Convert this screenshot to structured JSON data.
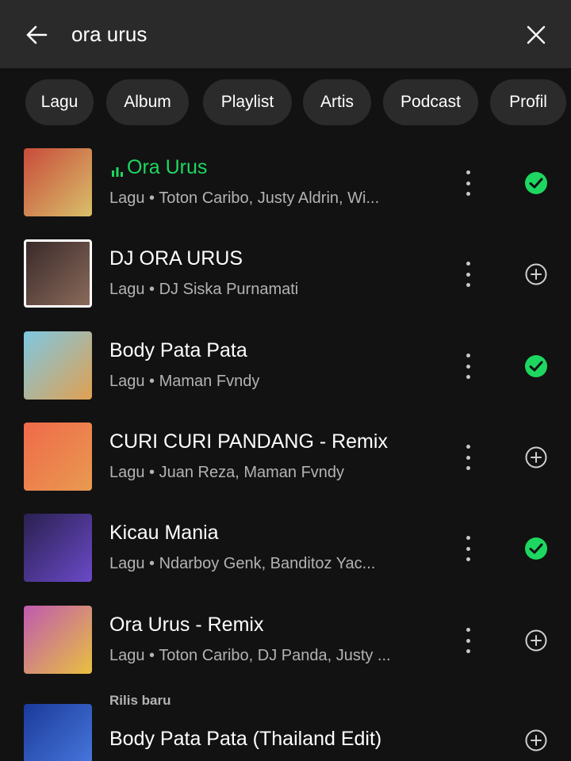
{
  "search": {
    "query": "ora urus"
  },
  "filters": [
    "Lagu",
    "Album",
    "Playlist",
    "Artis",
    "Podcast",
    "Profil"
  ],
  "results": [
    {
      "title": "Ora Urus",
      "subtitle": "Lagu • Toton Caribo, Justy Aldrin, Wi...",
      "saved": true,
      "playing": true,
      "cover_colors": [
        "#c94b3b",
        "#d8c06a"
      ]
    },
    {
      "title": "DJ ORA URUS",
      "subtitle": "Lagu • DJ Siska Purnamati",
      "saved": false,
      "playing": false,
      "cover_colors": [
        "#3a2a2a",
        "#8a6a5a"
      ]
    },
    {
      "title": "Body Pata Pata",
      "subtitle": "Lagu • Maman Fvndy",
      "saved": true,
      "playing": false,
      "cover_colors": [
        "#7ec8e3",
        "#e0a050"
      ]
    },
    {
      "title": "CURI CURI PANDANG - Remix",
      "subtitle": "Lagu • Juan Reza, Maman Fvndy",
      "saved": false,
      "playing": false,
      "cover_colors": [
        "#f06a4a",
        "#e89a50"
      ]
    },
    {
      "title": "Kicau Mania",
      "subtitle": "Lagu • Ndarboy Genk, Banditoz Yac...",
      "saved": true,
      "playing": false,
      "cover_colors": [
        "#2a2050",
        "#6a4ac8"
      ]
    },
    {
      "title": "Ora Urus - Remix",
      "subtitle": "Lagu • Toton Caribo, DJ Panda, Justy ...",
      "saved": false,
      "playing": false,
      "cover_colors": [
        "#c05ab0",
        "#e8c040"
      ]
    },
    {
      "title": "Body Pata Pata (Thailand Edit)",
      "subtitle": "",
      "label": "Rilis baru",
      "saved": false,
      "playing": false,
      "cover_colors": [
        "#1a3a9a",
        "#4a7ae0"
      ]
    }
  ],
  "colors": {
    "accent": "#1ed760",
    "background": "#121212",
    "topbar": "#2a2a2a",
    "chip": "#2b2b2b",
    "secondary_text": "#b3b3b3"
  }
}
